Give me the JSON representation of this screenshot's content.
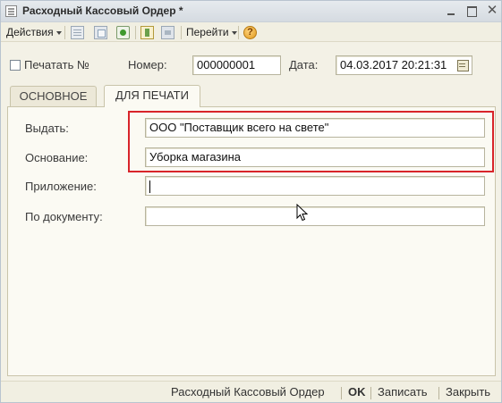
{
  "window": {
    "title": "Расходный Кассовый Ордер *"
  },
  "toolbar": {
    "actions_label": "Действия",
    "goto_label": "Перейти",
    "icons": [
      "doc-icon",
      "copy-icon",
      "refresh-icon",
      "post-icon",
      "unpost-icon",
      "help-icon"
    ],
    "help_glyph": "?"
  },
  "header": {
    "print_checkbox_label": "Печатать №",
    "print_checked": false,
    "number_label": "Номер:",
    "number_value": "000000001",
    "date_label": "Дата:",
    "date_value": "04.03.2017 20:21:31"
  },
  "tabs": [
    {
      "label": "ОСНОВНОЕ",
      "active": false
    },
    {
      "label": "ДЛЯ ПЕЧАТИ",
      "active": true
    }
  ],
  "print_form": {
    "issue_label": "Выдать:",
    "issue_value": "ООО \"Поставщик всего на свете\"",
    "basis_label": "Основание:",
    "basis_value": "Уборка магазина",
    "attachment_label": "Приложение:",
    "attachment_value": "",
    "document_label": "По документу:",
    "document_value": ""
  },
  "footer": {
    "print_form_label": "Расходный Кассовый Ордер",
    "ok_label": "OK",
    "save_label": "Записать",
    "close_label": "Закрыть"
  },
  "colors": {
    "highlight": "#d8242a",
    "window_bg": "#f3f1e6",
    "panel_bg": "#fbfaf3"
  }
}
